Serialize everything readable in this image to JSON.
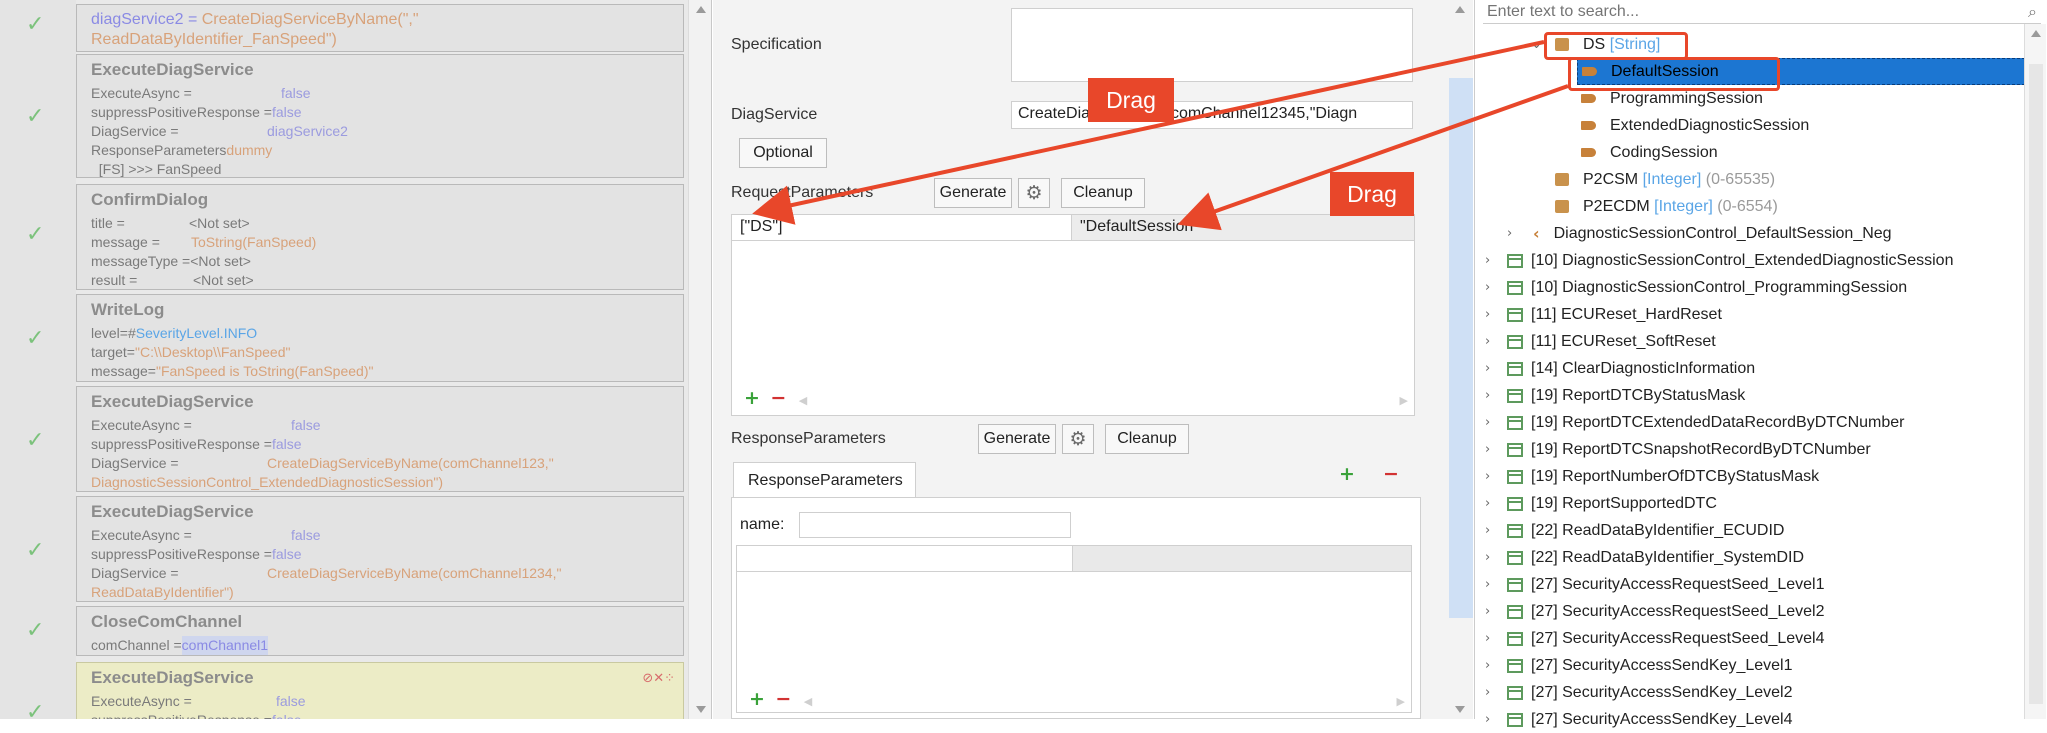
{
  "left_panel": {
    "steps": [
      {
        "kind": "assign",
        "line1a": "diagService2 = ",
        "line1b": "CreateDiagServiceByName(\",\"",
        "line2": "ReadDataByIdentifier_FanSpeed\")"
      },
      {
        "title": "ExecuteDiagService",
        "lines": [
          {
            "k": "ExecuteAsync = ",
            "v": "false"
          },
          {
            "k": "suppressPositiveResponse = ",
            "v": "false"
          },
          {
            "k": "DiagService = ",
            "v": "diagService2"
          },
          {
            "k": "ResponseParameters ",
            "v": "dummy"
          },
          {
            "k": "  [FS] >>> FanSpeed",
            "v": ""
          }
        ]
      },
      {
        "title": "ConfirmDialog",
        "lines": [
          {
            "k": "title = ",
            "v": "<Not set>"
          },
          {
            "k": "message = ",
            "v": "ToString(FanSpeed)"
          },
          {
            "k": "messageType = ",
            "v": "<Not set>"
          },
          {
            "k": "result = ",
            "v": "<Not set>"
          }
        ]
      },
      {
        "title": "WriteLog",
        "lines": [
          {
            "k": "level=#",
            "v": "SeverityLevel.INFO"
          },
          {
            "k": "target=",
            "v": "\"C:\\\\Desktop\\\\FanSpeed\""
          },
          {
            "k": "message=",
            "v": "\"FanSpeed is ToString(FanSpeed)\""
          }
        ]
      },
      {
        "title": "ExecuteDiagService",
        "lines": [
          {
            "k": "ExecuteAsync = ",
            "v": "false"
          },
          {
            "k": "suppressPositiveResponse = ",
            "v": "false"
          },
          {
            "k": "DiagService = ",
            "v": "CreateDiagServiceByName(comChannel123,\""
          },
          {
            "k": "",
            "v": "DiagnosticSessionControl_ExtendedDiagnosticSession\")"
          }
        ]
      },
      {
        "title": "ExecuteDiagService",
        "lines": [
          {
            "k": "ExecuteAsync = ",
            "v": "false"
          },
          {
            "k": "suppressPositiveResponse = ",
            "v": "false"
          },
          {
            "k": "DiagService = ",
            "v": "CreateDiagServiceByName(comChannel1234,\""
          },
          {
            "k": "",
            "v": "ReadDataByIdentifier\")"
          }
        ]
      },
      {
        "title": "CloseComChannel",
        "lines": [
          {
            "k": "comChannel = ",
            "v": "comChannel1"
          }
        ]
      },
      {
        "title": "ExecuteDiagService",
        "lines": [
          {
            "k": "ExecuteAsync = ",
            "v": "false"
          },
          {
            "k": "suppressPositiveResponse = ",
            "v": "false"
          }
        ]
      }
    ]
  },
  "middle_panel": {
    "specification_label": "Specification",
    "diagservice_label": "DiagService",
    "diagservice_value": "CreateDiag…yName(comChannel12345,\"Diagn",
    "optional_button": "Optional",
    "request_parameters_label": "RequestParameters",
    "generate_button": "Generate",
    "cleanup_button": "Cleanup",
    "request_grid": {
      "col1": "[\"DS\"]",
      "col2": "\"DefaultSession\""
    },
    "response_parameters_label": "ResponseParameters",
    "response_tab": "ResponseParameters",
    "name_label": "name:",
    "name_value": ""
  },
  "callouts": {
    "drag1": "Drag",
    "drag2": "Drag"
  },
  "right_panel": {
    "search_placeholder": "Enter text to search...",
    "tree": {
      "ds": {
        "name": "DS",
        "type": "[String]"
      },
      "children": [
        "DefaultSession",
        "ProgrammingSession",
        "ExtendedDiagnosticSession",
        "CodingSession"
      ],
      "p2csm": {
        "name": "P2CSM",
        "type": "[Integer]",
        "range": "(0-65535)"
      },
      "p2ecdm": {
        "name": "P2ECDM",
        "type": "[Integer]",
        "range": "(0-6554)"
      },
      "neg": "DiagnosticSessionControl_DefaultSession_Neg",
      "services": [
        "[10] DiagnosticSessionControl_ExtendedDiagnosticSession",
        "[10] DiagnosticSessionControl_ProgrammingSession",
        "[11] ECUReset_HardReset",
        "[11] ECUReset_SoftReset",
        "[14] ClearDiagnosticInformation",
        "[19] ReportDTCByStatusMask",
        "[19] ReportDTCExtendedDataRecordByDTCNumber",
        "[19] ReportDTCSnapshotRecordByDTCNumber",
        "[19] ReportNumberOfDTCByStatusMask",
        "[19] ReportSupportedDTC",
        "[22] ReadDataByIdentifier_ECUDID",
        "[22] ReadDataByIdentifier_SystemDID",
        "[27] SecurityAccessRequestSeed_Level1",
        "[27] SecurityAccessRequestSeed_Level2",
        "[27] SecurityAccessRequestSeed_Level4",
        "[27] SecurityAccessSendKey_Level1",
        "[27] SecurityAccessSendKey_Level2",
        "[27] SecurityAccessSendKey_Level4"
      ]
    }
  },
  "colors": {
    "accent_red": "#e8472a",
    "selection": "#1c76d2",
    "type_blue": "#5aa5e6"
  }
}
